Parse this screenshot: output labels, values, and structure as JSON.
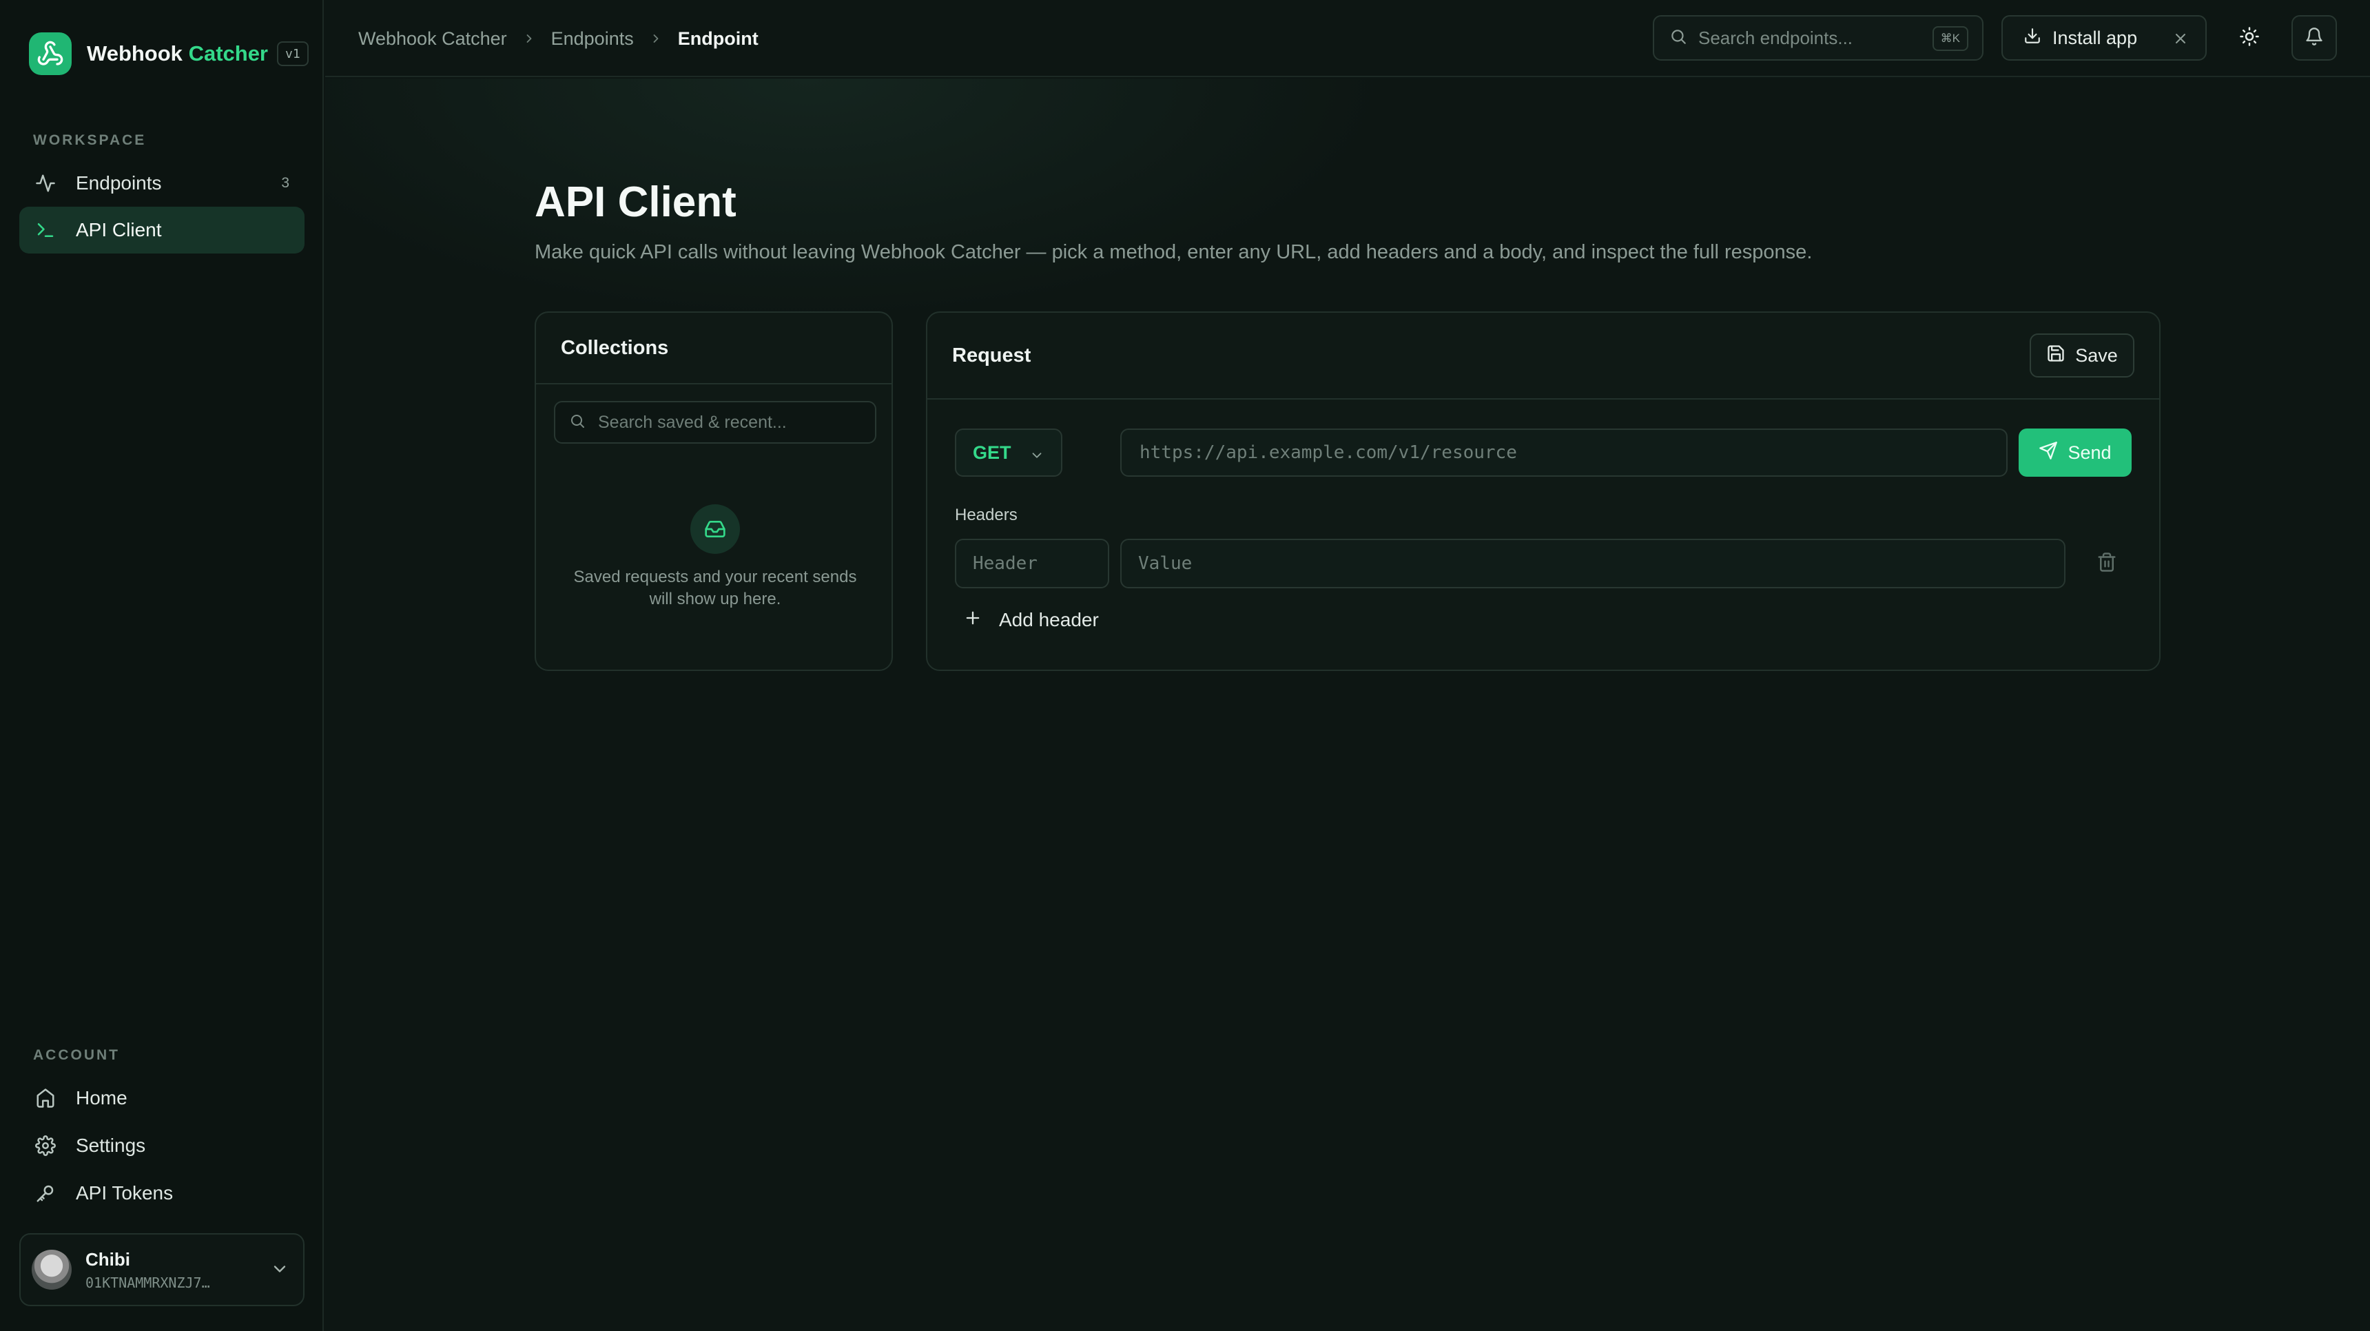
{
  "brand": {
    "name_primary": "Webhook",
    "name_accent": "Catcher",
    "version": "v1"
  },
  "sidebar": {
    "workspace_label": "WORKSPACE",
    "workspace_items": [
      {
        "label": "Endpoints",
        "count": "3",
        "icon": "activity-icon"
      },
      {
        "label": "API Client",
        "icon": "terminal-icon",
        "active": true
      }
    ],
    "account_label": "ACCOUNT",
    "account_items": [
      {
        "label": "Home",
        "icon": "home-icon"
      },
      {
        "label": "Settings",
        "icon": "gear-icon"
      },
      {
        "label": "API Tokens",
        "icon": "key-icon"
      }
    ],
    "user": {
      "name": "Chibi",
      "id": "01KTNAMMRXNZJ7…"
    }
  },
  "topbar": {
    "breadcrumbs": [
      "Webhook Catcher",
      "Endpoints",
      "Endpoint"
    ],
    "search_placeholder": "Search endpoints...",
    "search_shortcut": "⌘K",
    "install_label": "Install app"
  },
  "page": {
    "title": "API Client",
    "subtitle": "Make quick API calls without leaving Webhook Catcher — pick a method, enter any URL, add headers and a body, and inspect the full response."
  },
  "collections": {
    "title": "Collections",
    "search_placeholder": "Search saved & recent...",
    "empty_line1": "Saved requests and your recent sends",
    "empty_line2": "will show up here."
  },
  "request": {
    "title": "Request",
    "save_label": "Save",
    "method": "GET",
    "url_placeholder": "https://api.example.com/v1/resource",
    "send_label": "Send",
    "headers_label": "Headers",
    "header_key_placeholder": "Header",
    "header_value_placeholder": "Value",
    "add_header_label": "Add header"
  },
  "colors": {
    "accent": "#22c07a",
    "background": "#0d1613",
    "active_nav": "#163428"
  }
}
